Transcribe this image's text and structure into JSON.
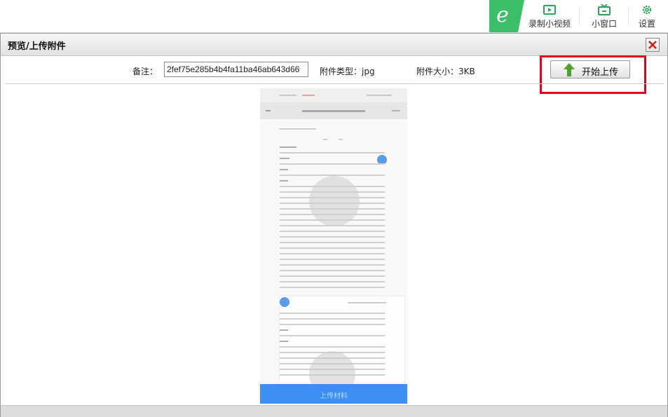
{
  "toolbar": {
    "items": [
      {
        "label": "录制小视频",
        "icon": "video-record-icon"
      },
      {
        "label": "小窗口",
        "icon": "tv-window-icon"
      },
      {
        "label": "设置",
        "icon": "gear-icon"
      }
    ],
    "logo": "e",
    "accent": "#3dbf6a"
  },
  "dialog": {
    "title": "预览/上传附件",
    "note_label": "备注：",
    "note_value": "2fef75e285b4b4fa11ba46ab643d66",
    "file_type": "附件类型：jpg",
    "file_size": "附件大小：3KB",
    "upload_label": "开始上传",
    "highlight_color": "#e3001b"
  },
  "preview": {
    "button_text": "上传材料"
  }
}
